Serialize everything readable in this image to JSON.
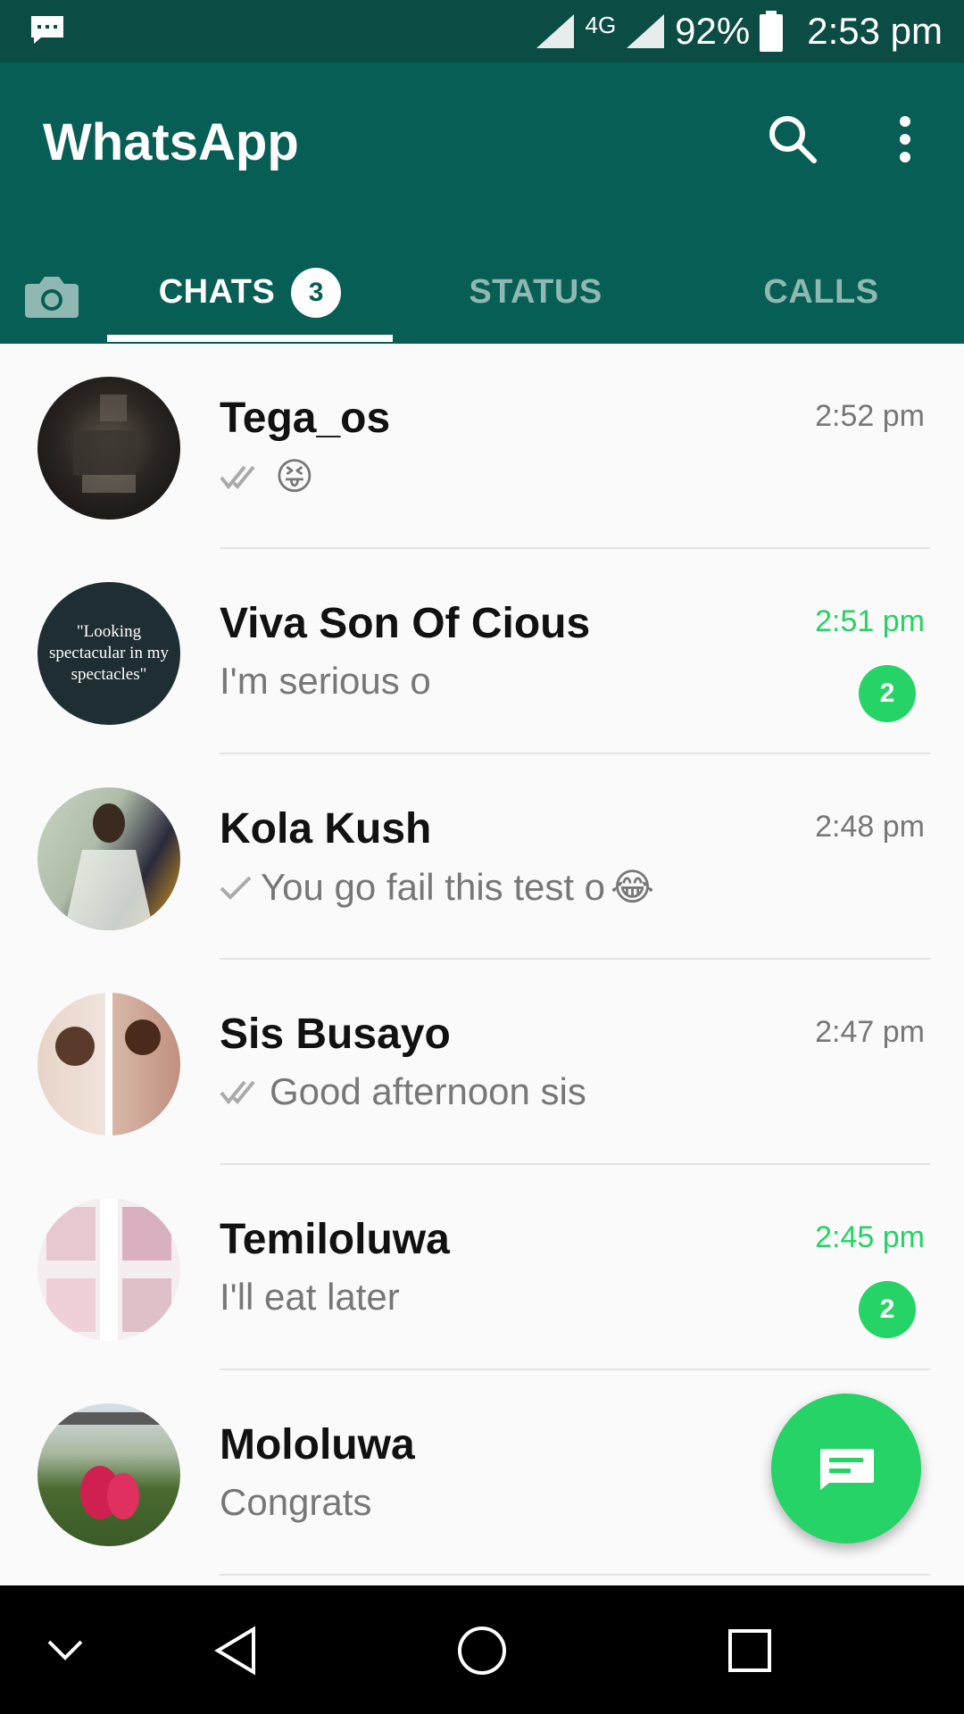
{
  "status_bar": {
    "network": "4G",
    "battery": "92%",
    "time": "2:53 pm",
    "icons": [
      "message-notification-icon",
      "signal-icon",
      "battery-icon"
    ]
  },
  "app_bar": {
    "title": "WhatsApp",
    "icons": [
      "search-icon",
      "more-options-icon"
    ],
    "accent_color": "#075e54"
  },
  "tabs": {
    "chats": {
      "label": "CHATS",
      "badge": "3"
    },
    "status": {
      "label": "STATUS"
    },
    "calls": {
      "label": "CALLS"
    },
    "camera_icon": "camera-icon"
  },
  "chats": [
    {
      "name": "Tega_os",
      "time": "2:52 pm",
      "preview": "",
      "tick": "double",
      "emoji": "😝",
      "unread": ""
    },
    {
      "name": "Viva Son Of Cious",
      "time": "2:51 pm",
      "preview": "I'm serious o",
      "tick": "",
      "emoji": "",
      "unread": "2",
      "avatar_text": "\"Looking spectacular in my spectacles\""
    },
    {
      "name": "Kola Kush",
      "time": "2:48 pm",
      "preview": "You go fail this test o",
      "tick": "single",
      "emoji": "😂",
      "unread": ""
    },
    {
      "name": "Sis Busayo",
      "time": "2:47 pm",
      "preview": "Good afternoon sis",
      "tick": "double",
      "emoji": "",
      "unread": ""
    },
    {
      "name": "Temiloluwa",
      "time": "2:45 pm",
      "preview": "I'll eat later",
      "tick": "",
      "emoji": "",
      "unread": "2"
    },
    {
      "name": "Mololuwa",
      "time": "",
      "preview": "Congrats",
      "tick": "",
      "emoji": "",
      "unread": ""
    }
  ],
  "fab": {
    "icon": "new-chat-icon",
    "color": "#25d366"
  },
  "nav_bar": {
    "icons": [
      "hide-nav-icon",
      "back-icon",
      "home-icon",
      "recents-icon"
    ]
  }
}
